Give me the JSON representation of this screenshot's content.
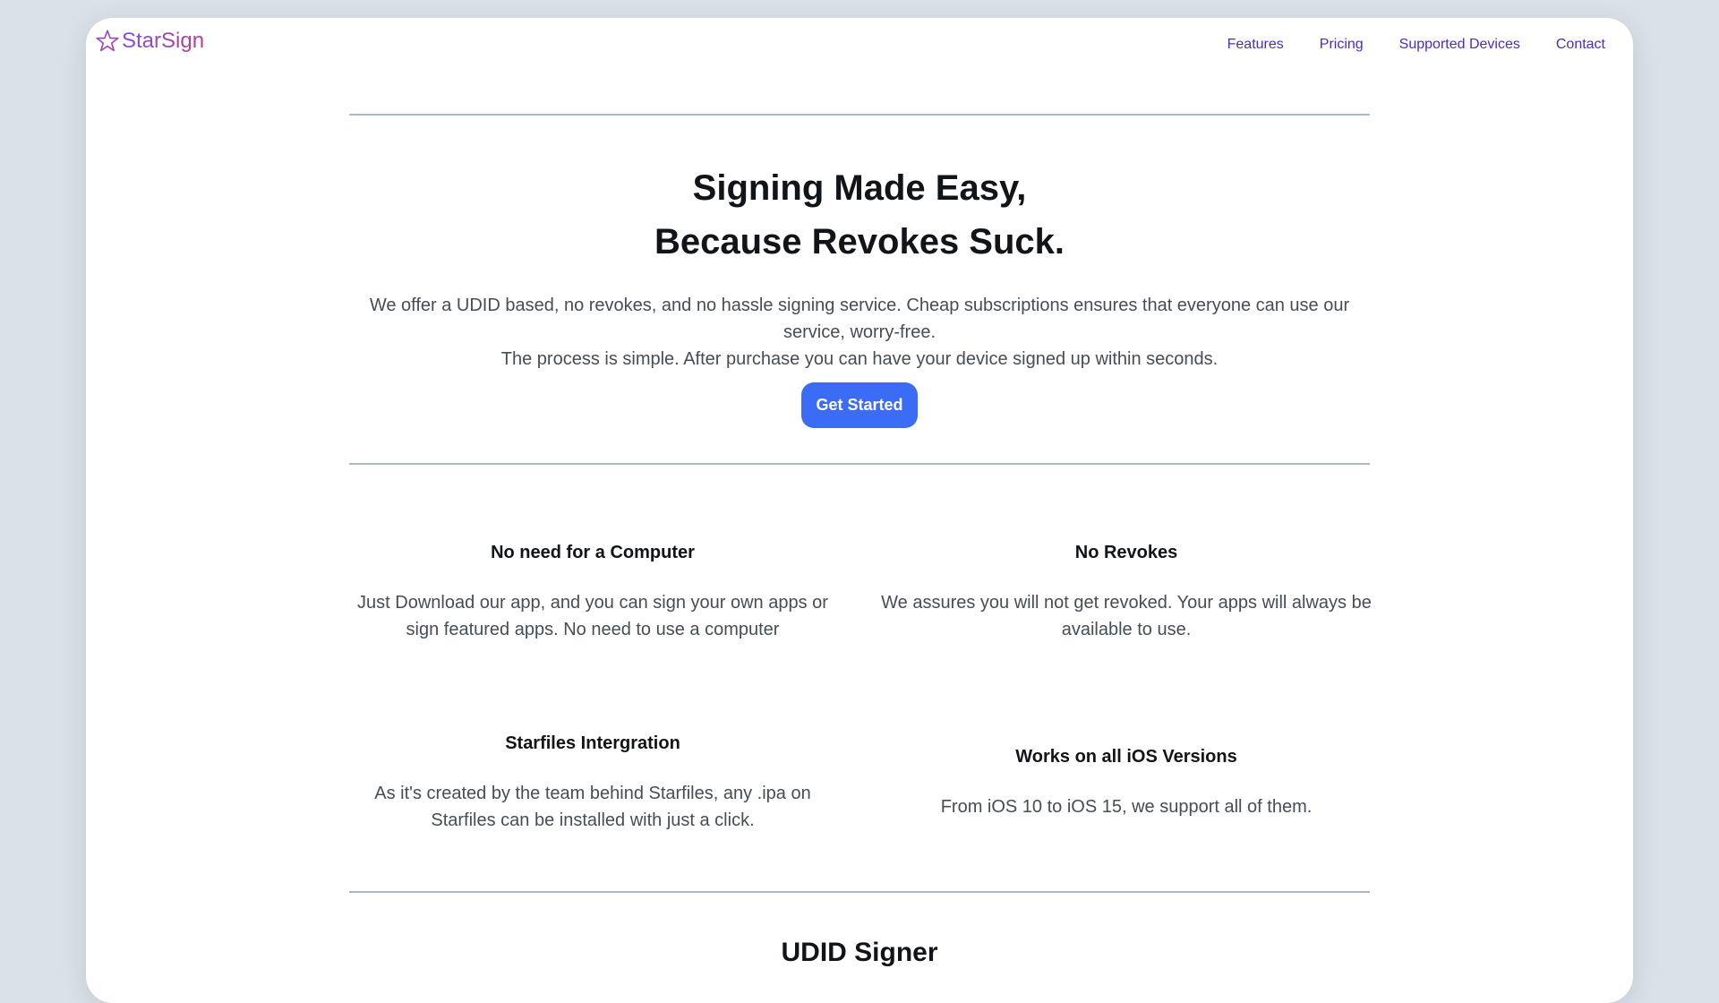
{
  "brand": {
    "name": "StarSign",
    "icon": "star-outline-icon",
    "gradient": [
      "#7d4fe0",
      "#b8408c"
    ]
  },
  "nav": {
    "items": [
      "Features",
      "Pricing",
      "Supported Devices",
      "Contact"
    ]
  },
  "hero": {
    "title_line1": "Signing Made Easy,",
    "title_line2": "Because Revokes Suck.",
    "description_line1": "We offer a UDID based, no revokes, and no hassle signing service. Cheap subscriptions ensures that everyone can use our service, worry-free.",
    "description_line2": "The process is simple. After purchase you can have your device signed up within seconds.",
    "cta_label": "Get Started"
  },
  "features": [
    {
      "title": "No need for a Computer",
      "text": "Just Download our app, and you can sign your own apps or sign featured apps. No need to use a computer"
    },
    {
      "title": "No Revokes",
      "text": "We assures you will not get revoked. Your apps will always be available to use."
    },
    {
      "title": "Starfiles Intergration",
      "text": "As it's created by the team behind Starfiles, any .ipa on Starfiles can be installed with just a click."
    },
    {
      "title": "Works on all iOS Versions",
      "text": "From iOS 10 to iOS 15, we support all of them."
    }
  ],
  "section": {
    "title": "UDID Signer"
  },
  "colors": {
    "accent": "#3b6cf5",
    "nav_link": "#4b2dbd",
    "divider": "#a9b9c9",
    "page_bg": "#dbe1e8"
  }
}
